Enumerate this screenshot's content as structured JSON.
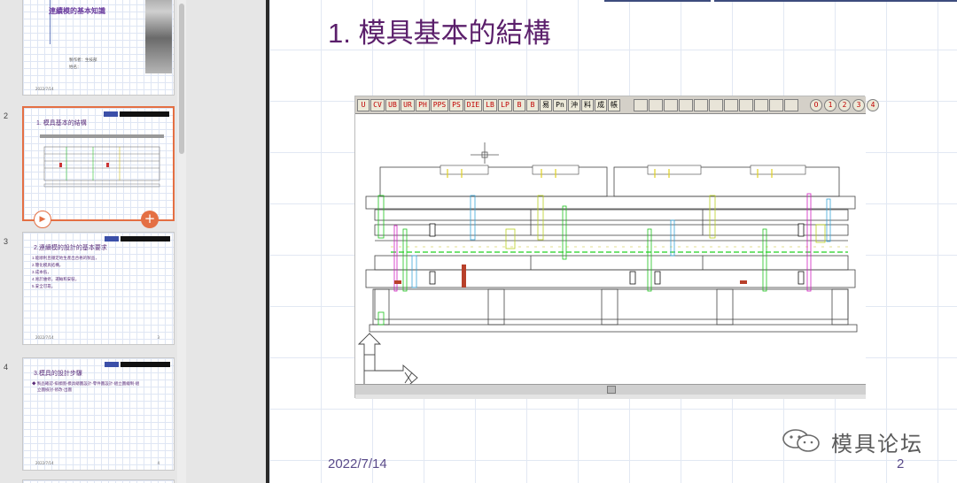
{
  "thumbnails": [
    {
      "number": "",
      "cover_title": "連續模的基本知識",
      "cover_sub1": "製作者：生技部",
      "cover_sub2": "姓名：",
      "date": "2022/7/14"
    },
    {
      "number": "2",
      "title": "1. 模具基本的結構",
      "selected": true
    },
    {
      "number": "3",
      "title": "2.連續模的設計的基本要求",
      "bullets": [
        "1.能順利且穩定地生產出合格的製品，",
        "2.簡化模具結構，",
        "3.成本低，",
        "4.易於維修，運輸和安裝，",
        "5.安全可靠。"
      ],
      "date": "2022/7/14",
      "page": "3"
    },
    {
      "number": "4",
      "title": "3.模具的設計步驟",
      "bullets": [
        "◆ 製品確認-排樣圖-模具總圖設計-零件圖設計-組立圖繪制-組",
        "立圖檢討-修改-出圖"
      ],
      "date": "2022/7/14",
      "page": "4"
    }
  ],
  "slide": {
    "title": "1. 模具基本的結構",
    "date": "2022/7/14",
    "page_number": "2"
  },
  "cad_toolbar": {
    "buttons": [
      "U",
      "CV",
      "UB",
      "UR",
      "PH",
      "PPS",
      "PS",
      "DIE",
      "LB",
      "LP",
      "B",
      "B",
      "易",
      "Pn",
      "沖",
      "料",
      "成",
      "帳"
    ],
    "right_buttons": [
      "O",
      "1",
      "2",
      "3",
      "4"
    ]
  },
  "watermark": {
    "text": "模具论坛"
  },
  "colors": {
    "title_purple": "#5b1f6b",
    "selection_orange": "#e46f43",
    "grid_blue": "#e2e8f3"
  }
}
